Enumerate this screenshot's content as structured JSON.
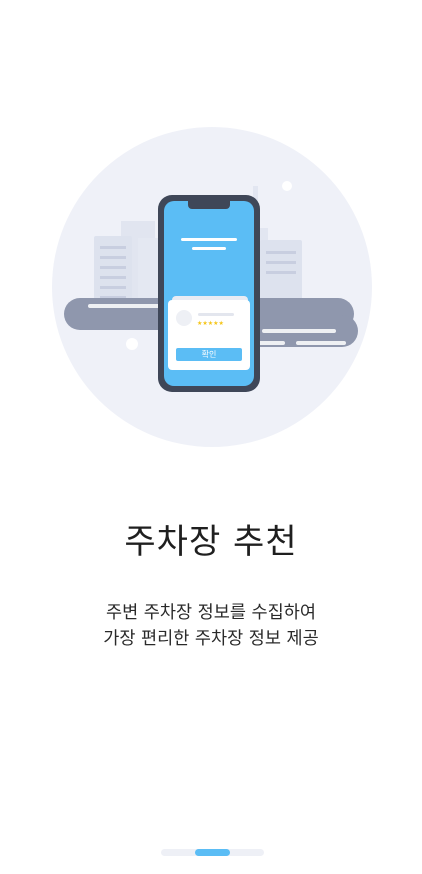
{
  "onboarding": {
    "title": "주차장 추천",
    "description_lines": [
      "주변 주차장 정보를 수집하여",
      "가장 편리한 주차장 정보 제공"
    ],
    "illustration": {
      "card_rating": "★★★★★",
      "card_button_label": "확인"
    },
    "pager": {
      "current_page": 2,
      "total_pages": 3
    }
  },
  "colors": {
    "accent": "#5bbdf5",
    "circle_bg": "#eff1f8",
    "road": "#8f97ad",
    "phone_frame": "#3f4758",
    "star": "#f5c518"
  }
}
